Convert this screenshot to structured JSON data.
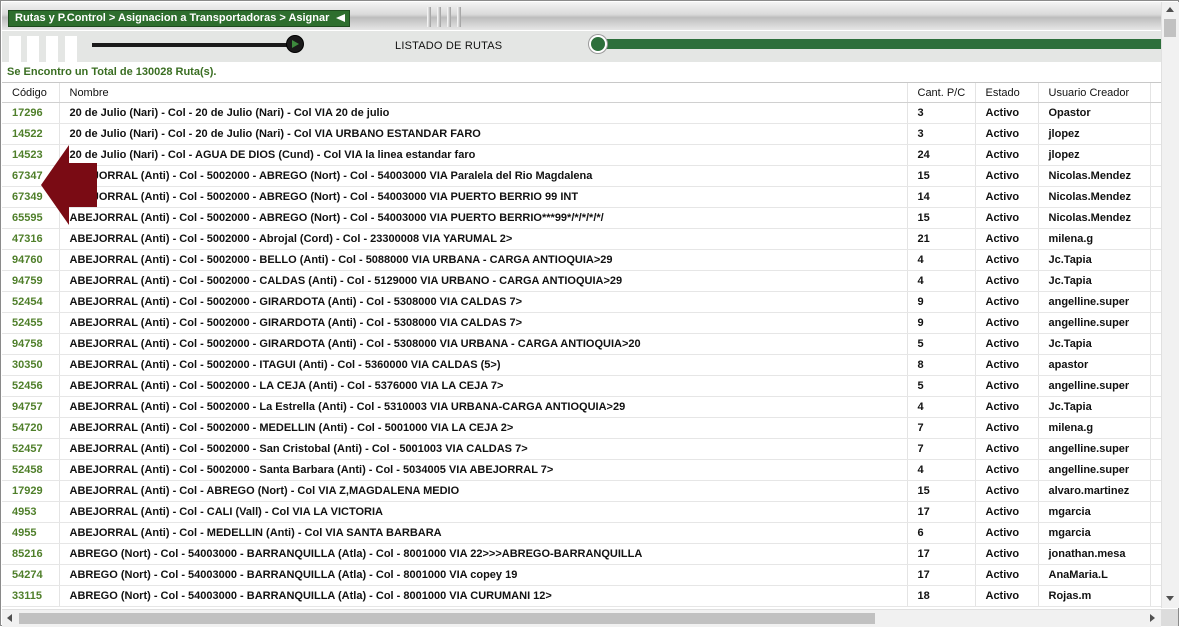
{
  "breadcrumb": "Rutas y P.Control > Asignacion a Transportadoras > Asignar",
  "list_title": "LISTADO DE RUTAS",
  "total_text": "Se Encontro un Total de 130028 Ruta(s).",
  "colors": {
    "accent_green": "#2d6f3b",
    "code_green": "#4f7f2a",
    "arrow_red": "#7a0b14"
  },
  "table": {
    "headers": [
      "Código",
      "Nombre",
      "Cant. P/C",
      "Estado",
      "Usuario Creador"
    ],
    "rows": [
      {
        "codigo": "17296",
        "nombre": "20 de Julio (Nari) - Col - 20 de Julio (Nari) - Col VIA 20 de julio",
        "cant": "3",
        "estado": "Activo",
        "usuario": "Opastor"
      },
      {
        "codigo": "14522",
        "nombre": "20 de Julio (Nari) - Col - 20 de Julio (Nari) - Col VIA URBANO ESTANDAR FARO",
        "cant": "3",
        "estado": "Activo",
        "usuario": "jlopez"
      },
      {
        "codigo": "14523",
        "nombre": "20 de Julio (Nari) - Col - AGUA DE DIOS (Cund) - Col VIA la linea estandar faro",
        "cant": "24",
        "estado": "Activo",
        "usuario": "jlopez"
      },
      {
        "codigo": "67347",
        "nombre": "ABEJORRAL (Anti) - Col - 5002000 - ABREGO (Nort) - Col - 54003000 VIA Paralela del Rio Magdalena",
        "cant": "15",
        "estado": "Activo",
        "usuario": "Nicolas.Mendez"
      },
      {
        "codigo": "67349",
        "nombre": "ABEJORRAL (Anti) - Col - 5002000 - ABREGO (Nort) - Col - 54003000 VIA PUERTO BERRIO 99 INT",
        "cant": "14",
        "estado": "Activo",
        "usuario": "Nicolas.Mendez"
      },
      {
        "codigo": "65595",
        "nombre": "ABEJORRAL (Anti) - Col - 5002000 - ABREGO (Nort) - Col - 54003000 VIA PUERTO BERRIO***99*/*/*/*/*/",
        "cant": "15",
        "estado": "Activo",
        "usuario": "Nicolas.Mendez"
      },
      {
        "codigo": "47316",
        "nombre": "ABEJORRAL (Anti) - Col - 5002000 - Abrojal (Cord) - Col - 23300008 VIA YARUMAL 2>",
        "cant": "21",
        "estado": "Activo",
        "usuario": "milena.g"
      },
      {
        "codigo": "94760",
        "nombre": "ABEJORRAL (Anti) - Col - 5002000 - BELLO (Anti) - Col - 5088000 VIA URBANA - CARGA ANTIOQUIA>29",
        "cant": "4",
        "estado": "Activo",
        "usuario": "Jc.Tapia"
      },
      {
        "codigo": "94759",
        "nombre": "ABEJORRAL (Anti) - Col - 5002000 - CALDAS (Anti) - Col - 5129000 VIA URBANO - CARGA ANTIOQUIA>29",
        "cant": "4",
        "estado": "Activo",
        "usuario": "Jc.Tapia"
      },
      {
        "codigo": "52454",
        "nombre": "ABEJORRAL (Anti) - Col - 5002000 - GIRARDOTA (Anti) - Col - 5308000 VIA CALDAS 7>",
        "cant": "9",
        "estado": "Activo",
        "usuario": "angelline.super"
      },
      {
        "codigo": "52455",
        "nombre": "ABEJORRAL (Anti) - Col - 5002000 - GIRARDOTA (Anti) - Col - 5308000 VIA CALDAS 7>",
        "cant": "9",
        "estado": "Activo",
        "usuario": "angelline.super"
      },
      {
        "codigo": "94758",
        "nombre": "ABEJORRAL (Anti) - Col - 5002000 - GIRARDOTA (Anti) - Col - 5308000 VIA URBANA - CARGA ANTIOQUIA>20",
        "cant": "5",
        "estado": "Activo",
        "usuario": "Jc.Tapia"
      },
      {
        "codigo": "30350",
        "nombre": "ABEJORRAL (Anti) - Col - 5002000 - ITAGUI (Anti) - Col - 5360000 VIA CALDAS (5>)",
        "cant": "8",
        "estado": "Activo",
        "usuario": "apastor"
      },
      {
        "codigo": "52456",
        "nombre": "ABEJORRAL (Anti) - Col - 5002000 - LA CEJA (Anti) - Col - 5376000 VIA LA CEJA 7>",
        "cant": "5",
        "estado": "Activo",
        "usuario": "angelline.super"
      },
      {
        "codigo": "94757",
        "nombre": "ABEJORRAL (Anti) - Col - 5002000 - La Estrella (Anti) - Col - 5310003 VIA URBANA-CARGA ANTIOQUIA>29",
        "cant": "4",
        "estado": "Activo",
        "usuario": "Jc.Tapia"
      },
      {
        "codigo": "54720",
        "nombre": "ABEJORRAL (Anti) - Col - 5002000 - MEDELLIN (Anti) - Col - 5001000 VIA LA CEJA 2>",
        "cant": "7",
        "estado": "Activo",
        "usuario": "milena.g"
      },
      {
        "codigo": "52457",
        "nombre": "ABEJORRAL (Anti) - Col - 5002000 - San Cristobal (Anti) - Col - 5001003 VIA CALDAS 7>",
        "cant": "7",
        "estado": "Activo",
        "usuario": "angelline.super"
      },
      {
        "codigo": "52458",
        "nombre": "ABEJORRAL (Anti) - Col - 5002000 - Santa Barbara (Anti) - Col - 5034005 VIA ABEJORRAL 7>",
        "cant": "4",
        "estado": "Activo",
        "usuario": "angelline.super"
      },
      {
        "codigo": "17929",
        "nombre": "ABEJORRAL (Anti) - Col - ABREGO (Nort) - Col VIA Z,MAGDALENA MEDIO",
        "cant": "15",
        "estado": "Activo",
        "usuario": "alvaro.martinez"
      },
      {
        "codigo": "4953",
        "nombre": "ABEJORRAL (Anti) - Col - CALI (Vall) - Col VIA LA VICTORIA",
        "cant": "17",
        "estado": "Activo",
        "usuario": "mgarcia"
      },
      {
        "codigo": "4955",
        "nombre": "ABEJORRAL (Anti) - Col - MEDELLIN (Anti) - Col VIA SANTA BARBARA",
        "cant": "6",
        "estado": "Activo",
        "usuario": "mgarcia"
      },
      {
        "codigo": "85216",
        "nombre": "ABREGO (Nort) - Col - 54003000 - BARRANQUILLA (Atla) - Col - 8001000 VIA 22>>>ABREGO-BARRANQUILLA",
        "cant": "17",
        "estado": "Activo",
        "usuario": "jonathan.mesa"
      },
      {
        "codigo": "54274",
        "nombre": "ABREGO (Nort) - Col - 54003000 - BARRANQUILLA (Atla) - Col - 8001000 VIA copey 19",
        "cant": "17",
        "estado": "Activo",
        "usuario": "AnaMaria.L"
      },
      {
        "codigo": "33115",
        "nombre": "ABREGO (Nort) - Col - 54003000 - BARRANQUILLA (Atla) - Col - 8001000 VIA CURUMANI 12>",
        "cant": "18",
        "estado": "Activo",
        "usuario": "Rojas.m"
      }
    ]
  }
}
